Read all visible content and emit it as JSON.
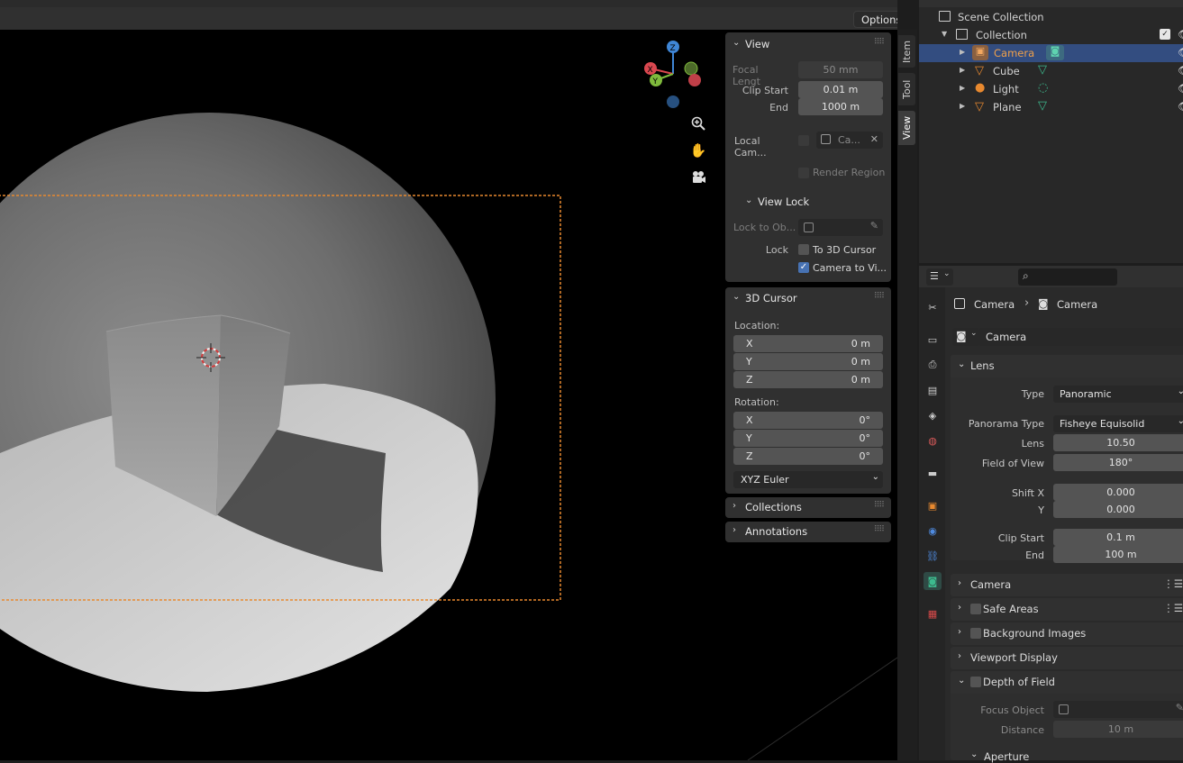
{
  "viewport": {
    "options_label": "Options",
    "tabs": [
      "Item",
      "Tool",
      "View"
    ]
  },
  "npanel": {
    "view": {
      "title": "View",
      "focal_length_label": "Focal Lengt",
      "focal_length_value": "50 mm",
      "clip_start_label": "Clip Start",
      "clip_start_value": "0.01 m",
      "end_label": "End",
      "end_value": "1000 m",
      "local_camera_label": "Local Cam...",
      "local_camera_value": "Ca...",
      "render_region_label": "Render Region",
      "view_lock_title": "View Lock",
      "lock_to_object_label": "Lock to Ob...",
      "lock_label": "Lock",
      "to_3d_cursor_label": "To 3D Cursor",
      "camera_to_view_label": "Camera to Vi..."
    },
    "cursor": {
      "title": "3D Cursor",
      "location_label": "Location:",
      "loc": [
        {
          "axis": "X",
          "value": "0 m"
        },
        {
          "axis": "Y",
          "value": "0 m"
        },
        {
          "axis": "Z",
          "value": "0 m"
        }
      ],
      "rotation_label": "Rotation:",
      "rot": [
        {
          "axis": "X",
          "value": "0°"
        },
        {
          "axis": "Y",
          "value": "0°"
        },
        {
          "axis": "Z",
          "value": "0°"
        }
      ],
      "rotation_mode": "XYZ Euler"
    },
    "collections_title": "Collections",
    "annotations_title": "Annotations"
  },
  "outliner": {
    "scene_collection": "Scene Collection",
    "collection": "Collection",
    "items": [
      "Camera",
      "Cube",
      "Light",
      "Plane"
    ]
  },
  "properties": {
    "breadcrumb_object": "Camera",
    "breadcrumb_data": "Camera",
    "datablock_name": "Camera",
    "lens_section": "Lens",
    "type_label": "Type",
    "type_value": "Panoramic",
    "panorama_type_label": "Panorama Type",
    "panorama_type_value": "Fisheye Equisolid",
    "lens_label": "Lens",
    "lens_value": "10.50",
    "fov_label": "Field of View",
    "fov_value": "180°",
    "shift_x_label": "Shift X",
    "shift_x_value": "0.000",
    "shift_y_label": "Y",
    "shift_y_value": "0.000",
    "clip_start_label": "Clip Start",
    "clip_start_value": "0.1 m",
    "clip_end_label": "End",
    "clip_end_value": "100 m",
    "camera_section": "Camera",
    "safe_areas_section": "Safe Areas",
    "background_images_section": "Background Images",
    "viewport_display_section": "Viewport Display",
    "dof_section": "Depth of Field",
    "focus_object_label": "Focus Object",
    "distance_label": "Distance",
    "distance_value": "10 m",
    "aperture_section": "Aperture"
  },
  "colors": {
    "accent_blue": "#4772b3",
    "selection_row": "#334d80",
    "camera_orange": "#e8892f",
    "data_green": "#3dba8e",
    "gizmo_x": "#d9474f",
    "gizmo_y": "#7fba3c",
    "gizmo_z": "#3f86d6"
  }
}
